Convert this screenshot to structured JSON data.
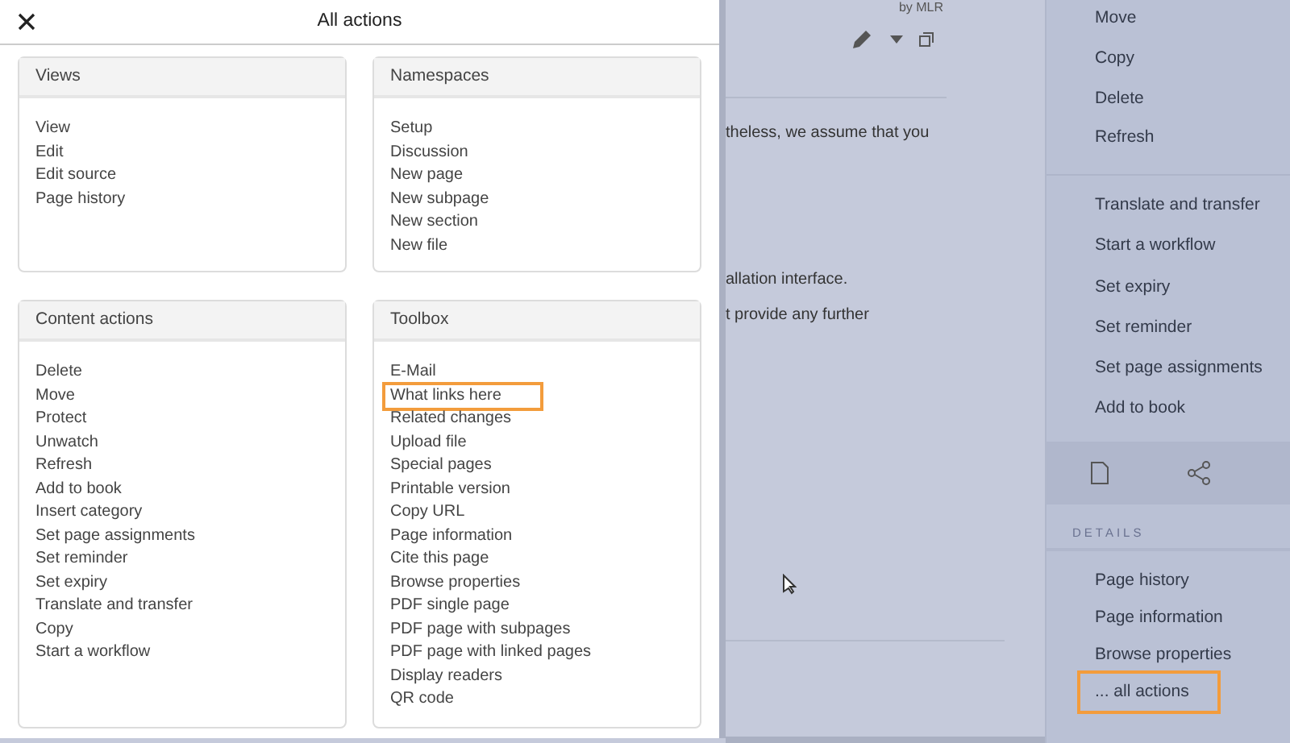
{
  "dialog": {
    "title": "All actions",
    "cards": [
      {
        "title": "Views",
        "items": [
          {
            "label": "View",
            "highlighted": false
          },
          {
            "label": "Edit",
            "highlighted": false
          },
          {
            "label": "Edit source",
            "highlighted": false
          },
          {
            "label": "Page history",
            "highlighted": false
          }
        ]
      },
      {
        "title": "Namespaces",
        "items": [
          {
            "label": "Setup",
            "highlighted": false
          },
          {
            "label": "Discussion",
            "highlighted": false
          },
          {
            "label": "New page",
            "highlighted": false
          },
          {
            "label": "New subpage",
            "highlighted": false
          },
          {
            "label": "New section",
            "highlighted": false
          },
          {
            "label": "New file",
            "highlighted": false
          }
        ]
      },
      {
        "title": "Content actions",
        "items": [
          {
            "label": "Delete",
            "highlighted": false
          },
          {
            "label": "Move",
            "highlighted": false
          },
          {
            "label": "Protect",
            "highlighted": false
          },
          {
            "label": "Unwatch",
            "highlighted": false
          },
          {
            "label": "Refresh",
            "highlighted": false
          },
          {
            "label": "Add to book",
            "highlighted": false
          },
          {
            "label": "Insert category",
            "highlighted": false
          },
          {
            "label": "Set page assignments",
            "highlighted": false
          },
          {
            "label": "Set reminder",
            "highlighted": false
          },
          {
            "label": "Set expiry",
            "highlighted": false
          },
          {
            "label": "Translate and transfer",
            "highlighted": false
          },
          {
            "label": "Copy",
            "highlighted": false
          },
          {
            "label": "Start a workflow",
            "highlighted": false
          }
        ]
      },
      {
        "title": "Toolbox",
        "items": [
          {
            "label": "E-Mail",
            "highlighted": false
          },
          {
            "label": "What links here",
            "highlighted": true
          },
          {
            "label": "Related changes",
            "highlighted": false
          },
          {
            "label": "Upload file",
            "highlighted": false
          },
          {
            "label": "Special pages",
            "highlighted": false
          },
          {
            "label": "Printable version",
            "highlighted": false
          },
          {
            "label": "Copy URL",
            "highlighted": false
          },
          {
            "label": "Page information",
            "highlighted": false
          },
          {
            "label": "Cite this page",
            "highlighted": false
          },
          {
            "label": "Browse properties",
            "highlighted": false
          },
          {
            "label": "PDF single page",
            "highlighted": false
          },
          {
            "label": "PDF page with subpages",
            "highlighted": false
          },
          {
            "label": "PDF page with linked pages",
            "highlighted": false
          },
          {
            "label": "Display readers",
            "highlighted": false
          },
          {
            "label": "QR code",
            "highlighted": false
          }
        ]
      }
    ]
  },
  "page": {
    "author": "by MLR",
    "lines": [
      "theless, we assume that you",
      "allation interface.",
      "t provide any further"
    ]
  },
  "sidebar": {
    "group_1": [
      "Move",
      "Copy",
      "Delete",
      "Refresh"
    ],
    "group_2": [
      "Translate and transfer",
      "Start a workflow",
      "Set expiry",
      "Set reminder",
      "Set page assignments",
      "Add to book"
    ],
    "details_heading": "DETAILS",
    "details": [
      {
        "label": "Page history",
        "highlighted": false
      },
      {
        "label": "Page information",
        "highlighted": false
      },
      {
        "label": "Browse properties",
        "highlighted": false
      },
      {
        "label": "... all actions",
        "highlighted": true
      }
    ]
  }
}
